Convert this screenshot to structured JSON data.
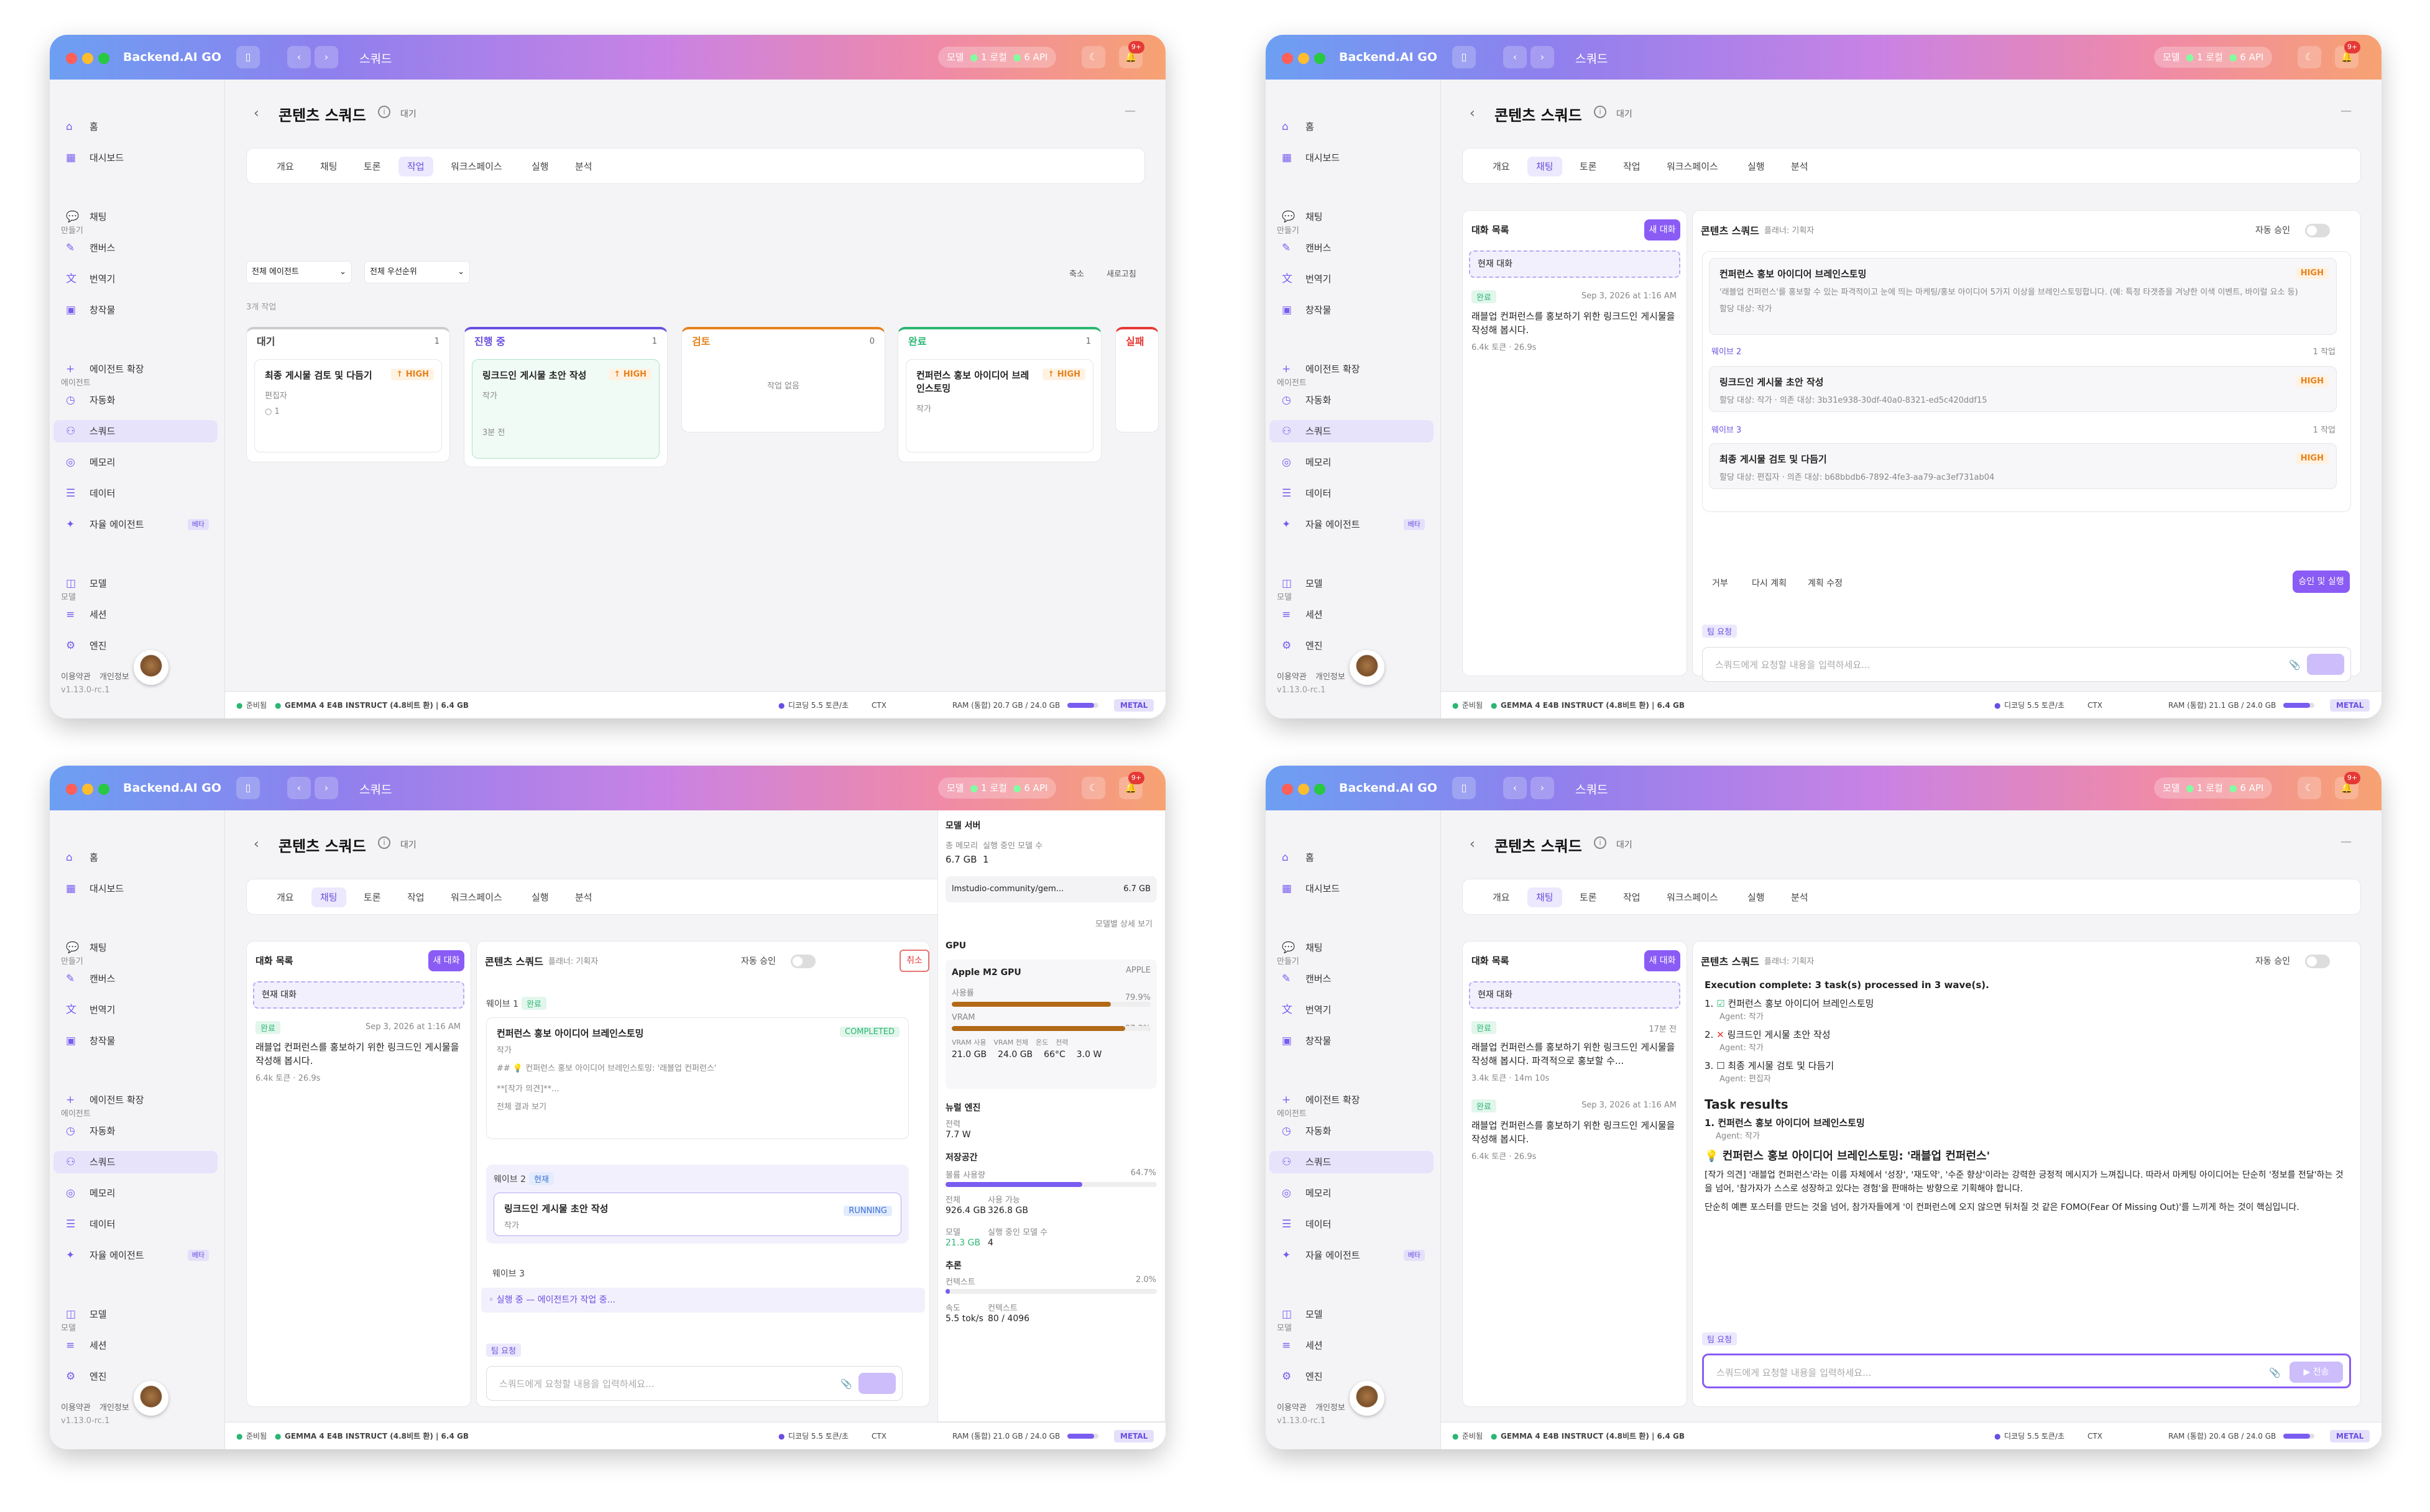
{
  "app": {
    "title": "Backend.AI GO",
    "version": "v1.13.0-rc.1",
    "page_title": "스쿼드",
    "pills": [
      "모델",
      "1 로컬",
      "6 API"
    ],
    "notif": "9+"
  },
  "sidebar": {
    "home": "홈",
    "dashboard": "대시보드",
    "sec_make": "만들기",
    "chat": "채팅",
    "canvas": "캔버스",
    "translate": "번역기",
    "creative": "창작물",
    "sec_agent": "에이전트",
    "agent_ext": "에이전트 확장",
    "automation": "자동화",
    "squad": "스쿼드",
    "memory": "메모리",
    "data": "데이터",
    "autonomous": "자율 에이전트",
    "beta": "베타",
    "sec_model": "모델",
    "model": "모델",
    "session": "세션",
    "engine": "엔진",
    "terms": "이용약관",
    "privacy": "개인정보"
  },
  "squad": {
    "title": "콘텐츠 스쿼드",
    "state": "대기",
    "tabs": [
      "개요",
      "채팅",
      "토론",
      "작업",
      "워크스페이스",
      "실행",
      "분석"
    ]
  },
  "status": {
    "ready": "준비됨",
    "model": "GEMMA 4 E4B INSTRUCT (4.8비트 환) | 6.4 GB",
    "decode": "디코딩 5.5 토큰/초",
    "ctx": "CTX",
    "ram1": "RAM (통합) 20.7 GB / 24.0 GB",
    "ram2": "RAM (통합) 21.1 GB / 24.0 GB",
    "ram3": "RAM (통합) 21.0 GB / 24.0 GB",
    "ram4": "RAM (통합) 20.4 GB / 24.0 GB",
    "metal": "METAL"
  },
  "board": {
    "filter_agent": "전체 에이전트",
    "filter_priority": "전체 우선순위",
    "sort": "축소",
    "refresh": "새로고침",
    "count": "3개 작업",
    "cols": [
      {
        "name": "대기",
        "n": "1"
      },
      {
        "name": "진행 중",
        "n": "1"
      },
      {
        "name": "검토",
        "n": "0"
      },
      {
        "name": "완료",
        "n": "1"
      },
      {
        "name": "실패",
        "n": ""
      }
    ],
    "c1": {
      "title": "최종 게시물 검토 및 다듬기",
      "pri": "↑ HIGH",
      "agent": "편집자",
      "meta": "○ 1"
    },
    "c2": {
      "title": "링크드인 게시물 초안 작성",
      "pri": "↑ HIGH",
      "agent": "작가",
      "meta": "3분 전"
    },
    "c3": "작업 없음",
    "c4": {
      "title": "컨퍼런스 홍보 아이디어 브레인스토밍",
      "pri": "↑ HIGH",
      "agent": "작가"
    }
  },
  "chat": {
    "list_title": "대화 목록",
    "new": "새 대화",
    "current": "현재 대화",
    "done": "완료",
    "date": "Sep 3, 2026 at 1:16 AM",
    "date2": "17분 전",
    "conv1": "래블업 컨퍼런스를 홍보하기 위한 링크드인 게시물을 작성해 봅시다.",
    "meta1": "6.4k 토큰 · 26.9s",
    "conv2": "래블업 컨퍼런스를 홍보하기 위한 링크드인 게시물을 작성해 봅시다. 파격적으로 홍보할 수...",
    "meta2": "3.4k 토큰 · 14m 10s",
    "header": "콘텐츠 스쿼드",
    "header_sub": "플래너: 기획자",
    "auto": "자동 승인",
    "cancel": "취소",
    "team_req": "팀 요청",
    "placeholder": "스쿼드에게 요청할 내용을 입력하세요...",
    "send": "▶ 전송",
    "plan_t1": "컨퍼런스 홍보 아이디어 브레인스토밍",
    "plan_d1": "'래블업 컨퍼런스'를 홍보할 수 있는 파격적이고 눈에 띄는 마케팅/홍보 아이디어 5가지 이상을 브레인스토밍합니다. (예: 특정 타겟층을 겨냥한 이색 이벤트, 바이럴 요소 등)",
    "assign": "할당 대상: 작가",
    "wave2": "웨이브 2",
    "wave3": "웨이브 3",
    "one": "1 작업",
    "high": "HIGH",
    "plan_t2": "링크드인 게시물 초안 작성",
    "plan_a2": "할당 대상: 작가 · 의존 대상: 3b31e938-30df-40a0-8321-ed5c420ddf15",
    "plan_t3": "최종 게시물 검토 및 다듬기",
    "plan_a3": "할당 대상: 편집자 · 의존 대상: b68bbdb6-7892-4fe3-aa79-ac3ef731ab04",
    "reject": "거부",
    "replan": "다시 계획",
    "edit": "계획 수정",
    "approve": "승인 및 실행",
    "wave1": "웨이브 1",
    "w_done": "완료",
    "w_cur": "현재",
    "completed": "COMPLETED",
    "running": "RUNNING",
    "agent_writer": "작가",
    "w1_text": "## 💡 컨퍼런스 홍보 아이디어 브레인스토밍: '래블업 컨퍼런스'",
    "w1_note": "**[작가 의견]**...",
    "w1_more": "전체 결과 보기",
    "running_bar": "◦ 실행 중 — 에이전트가 작업 중...",
    "exec": "Execution complete: 3 task(s) processed in 3 wave(s).",
    "r1": "컨퍼런스 홍보 아이디어 브레인스토밍",
    "r2": "링크드인 게시물 초안 작성",
    "r3": "최종 게시물 검토 및 다듬기",
    "agent_w": "Agent: 작가",
    "agent_e": "Agent: 편집자",
    "task_results": "Task results",
    "tr1": "1. 컨퍼런스 홍보 아이디어 브레인스토밍",
    "tr_agent": "Agent: 작가",
    "tr_h": "컨퍼런스 홍보 아이디어 브레인스토밍: '래블업 컨퍼런스'",
    "tr_p1": "[작가 의견] '래블업 컨퍼런스'라는 이름 자체에서 '성장', '재도약', '수준 향상'이라는 강력한 긍정적 메시지가 느껴집니다. 따라서 마케팅 아이디어는 단순히 '정보를 전달'하는 것을 넘어, '참가자가 스스로 성장하고 있다는 경험'을 판매하는 방향으로 기획해야 합니다.",
    "tr_p2": "단순히 예쁜 포스터를 만드는 것을 넘어, 참가자들에게 '이 컨퍼런스에 오지 않으면 뒤처질 것 같은 FOMO(Fear Of Missing Out)'를 느끼게 하는 것이 핵심입니다."
  },
  "stats": {
    "server": "모델 서버",
    "mem": "총 메모리",
    "loaded": "실행 중인 모델 수",
    "mem_v": "6.7 GB",
    "loaded_v": "1",
    "model_name": "lmstudio-community/gem...",
    "model_size": "6.7 GB",
    "detail": "모델별 상세 보기",
    "gpu": "GPU",
    "gpu_name": "Apple M2 GPU",
    "apple": "APPLE",
    "usage": "사용률",
    "usage_v": "79.9%",
    "vram": "VRAM",
    "vram_v": "87.3%",
    "vram_used": "VRAM 사용",
    "vram_total": "VRAM 전체",
    "temp": "온도",
    "power": "전력",
    "vu": "21.0 GB",
    "vt": "24.0 GB",
    "tmp": "66°C",
    "pw": "3.0 W",
    "npu": "뉴럴 엔진",
    "npu_p": "전력",
    "npu_v": "7.7 W",
    "disk": "저장공간",
    "disk_use": "볼륨 사용량",
    "disk_pct": "64.7%",
    "total": "전체",
    "avail": "사용 가능",
    "tv": "926.4 GB",
    "av": "326.8 GB",
    "model": "모델",
    "rm": "실행 중인 모델 수",
    "mv": "21.3 GB",
    "rv": "4",
    "infer": "추론",
    "ctx": "컨텍스트",
    "ctx_v": "2.0%",
    "speed": "속도",
    "ctxt": "컨텍스트",
    "sp_v": "5.5 tok/s",
    "ct_v": "80 / 4096",
    "usage_frac": 0.799,
    "vram_frac": 0.873,
    "disk_frac": 0.647,
    "ctx_frac": 0.02
  }
}
